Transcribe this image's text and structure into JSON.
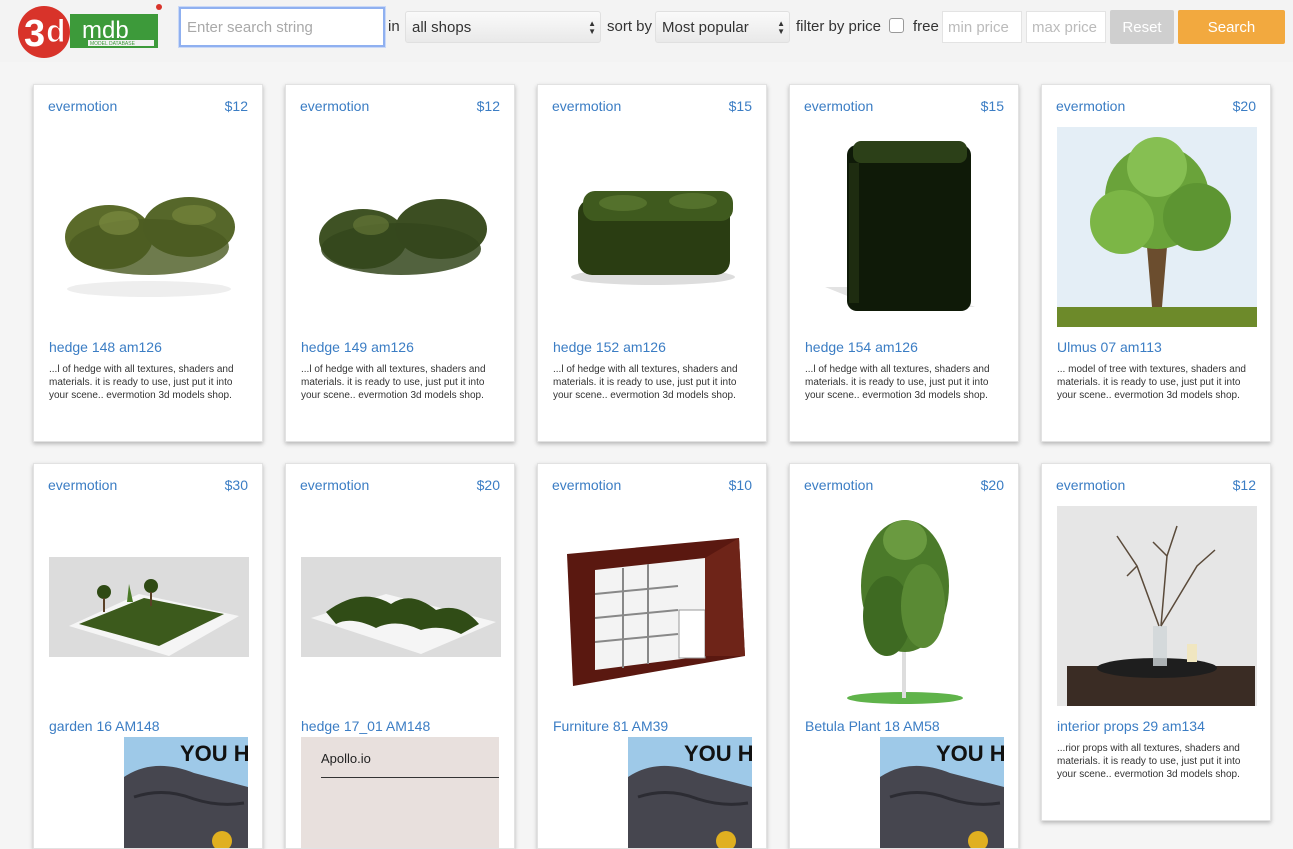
{
  "header": {
    "logo_text": "3dmdb",
    "logo_sub": "MODEL DATABASE",
    "search_placeholder": "Enter search string",
    "in_label": "in",
    "shop_select": "all shops",
    "sort_label": "sort by",
    "sort_select": "Most popular",
    "filter_label": "filter by price",
    "free_label": "free",
    "min_placeholder": "min price",
    "max_placeholder": "max price",
    "reset_label": "Reset",
    "search_label": "Search"
  },
  "cards": [
    {
      "shop": "evermotion",
      "price": "$12",
      "title": "hedge 148 am126",
      "desc": "...l of hedge with all textures, shaders and materials. it is ready to use, just put it into your scene.. evermotion 3d models shop.",
      "image": "hedge-low"
    },
    {
      "shop": "evermotion",
      "price": "$12",
      "title": "hedge 149 am126",
      "desc": "...l of hedge with all textures, shaders and materials. it is ready to use, just put it into your scene.. evermotion 3d models shop.",
      "image": "hedge-low"
    },
    {
      "shop": "evermotion",
      "price": "$15",
      "title": "hedge 152 am126",
      "desc": "...l of hedge with all textures, shaders and materials. it is ready to use, just put it into your scene.. evermotion 3d models shop.",
      "image": "hedge-box"
    },
    {
      "shop": "evermotion",
      "price": "$15",
      "title": "hedge 154 am126",
      "desc": "...l of hedge with all textures, shaders and materials. it is ready to use, just put it into your scene.. evermotion 3d models shop.",
      "image": "hedge-tall"
    },
    {
      "shop": "evermotion",
      "price": "$20",
      "title": "Ulmus 07 am113",
      "desc": "... model of tree with textures, shaders and materials. it is ready to use, just put it into your scene.. evermotion 3d models shop.",
      "image": "tree"
    },
    {
      "shop": "evermotion",
      "price": "$30",
      "title": "garden 16 AM148",
      "desc": "",
      "image": "garden"
    },
    {
      "shop": "evermotion",
      "price": "$20",
      "title": "hedge 17_01 AM148",
      "desc": "",
      "image": "garden-hedge"
    },
    {
      "shop": "evermotion",
      "price": "$10",
      "title": "Furniture 81 AM39",
      "desc": "",
      "image": "furniture"
    },
    {
      "shop": "evermotion",
      "price": "$20",
      "title": "Betula Plant 18 AM58",
      "desc": "",
      "image": "birch"
    },
    {
      "shop": "evermotion",
      "price": "$12",
      "title": "interior props 29 am134",
      "desc": "...rior props with all textures, shaders and materials. it is ready to use, just put it into your scene.. evermotion 3d models shop.",
      "image": "interior"
    }
  ],
  "ads": [
    {
      "text": "YOU HA"
    },
    {
      "text": "Apollo.io"
    },
    {
      "text": "YOU HA"
    },
    {
      "text": "YOU HA"
    }
  ]
}
